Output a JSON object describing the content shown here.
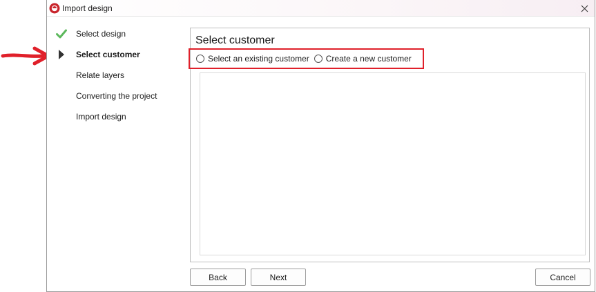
{
  "window": {
    "title": "Import design",
    "app_icon": "app-logo-icon",
    "close_icon": "close-icon"
  },
  "steps": [
    {
      "label": "Select design",
      "state": "completed",
      "icon": "checkmark-icon"
    },
    {
      "label": "Select customer",
      "state": "current",
      "icon": "triangle-right-icon"
    },
    {
      "label": "Relate layers",
      "state": "pending"
    },
    {
      "label": "Converting the project",
      "state": "pending"
    },
    {
      "label": "Import design",
      "state": "pending"
    }
  ],
  "main": {
    "title": "Select customer",
    "radio_options": [
      {
        "label": "Select an existing customer",
        "checked": false
      },
      {
        "label": "Create a new customer",
        "checked": false
      }
    ]
  },
  "buttons": {
    "back": "Back",
    "next": "Next",
    "cancel": "Cancel"
  },
  "colors": {
    "annotation_red": "#e0202a",
    "check_green": "#5cb85c",
    "current_marker": "#333333"
  }
}
